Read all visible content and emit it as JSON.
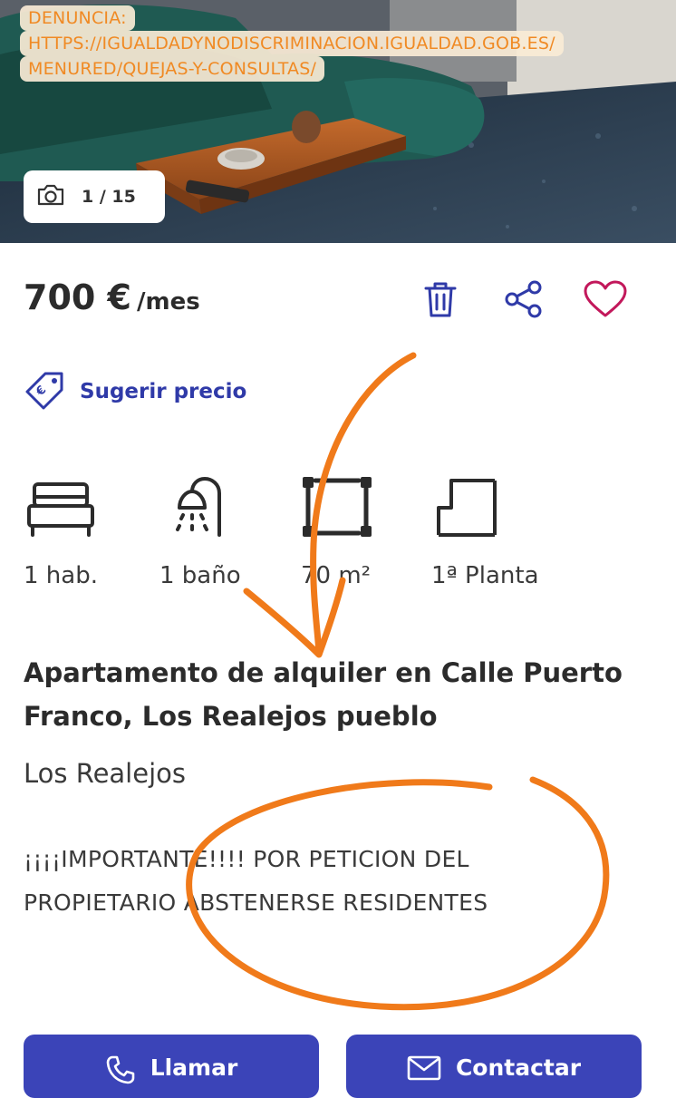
{
  "gallery": {
    "overlay_lines": [
      "DENUNCIA:",
      "HTTPS://IGUALDADYNODISCRIMINACION.IGUALDAD.GOB.ES/",
      "MENURED/QUEJAS-Y-CONSULTAS/"
    ],
    "counter": "1 / 15",
    "counter_icon": "camera-icon"
  },
  "listing": {
    "price": "700 €",
    "price_unit": "/mes",
    "actions": [
      {
        "name": "delete",
        "icon": "trash-icon"
      },
      {
        "name": "share",
        "icon": "share-icon"
      },
      {
        "name": "favorite",
        "icon": "heart-icon"
      }
    ],
    "suggest_price": "Sugerir precio",
    "features": [
      {
        "icon": "bed-icon",
        "label": "1 hab."
      },
      {
        "icon": "shower-icon",
        "label": "1 baño"
      },
      {
        "icon": "area-icon",
        "label": "70 m²"
      },
      {
        "icon": "floor-icon",
        "label": "1ª Planta"
      }
    ],
    "title": "Apartamento de alquiler en Calle Puerto Franco, Los Realejos pueblo",
    "location": "Los Realejos",
    "description_lines": [
      "¡¡¡¡IMPORTANTE!!!! POR PETICION DEL",
      "PROPIETARIO ABSTENERSE RESIDENTES"
    ]
  },
  "buttons": {
    "call": "Llamar",
    "contact": "Contactar"
  },
  "colors": {
    "accent": "#3b44b8",
    "link": "#2f3aa8",
    "favorite": "#c2185b",
    "annotation": "#f07a1a"
  }
}
